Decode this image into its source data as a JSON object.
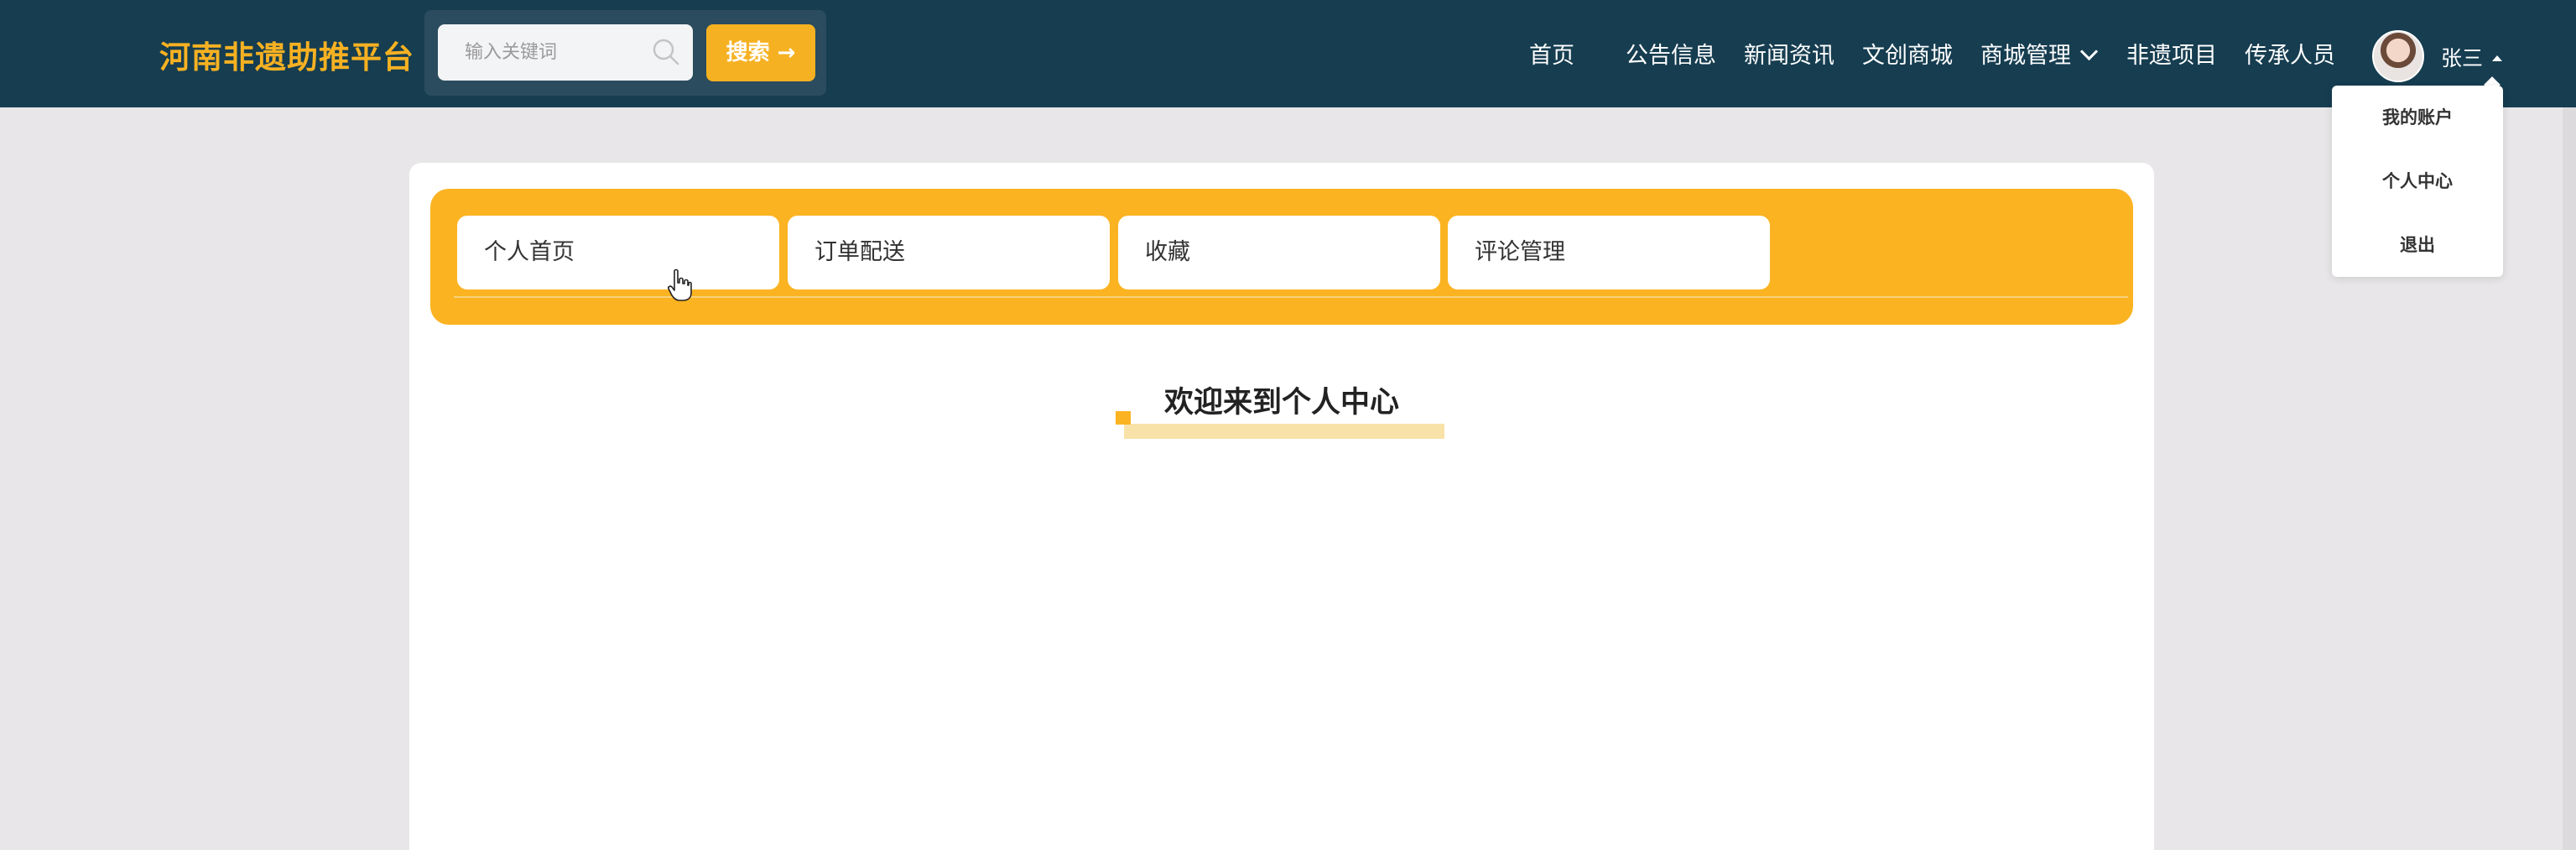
{
  "header": {
    "brand": "河南非遗助推平台",
    "search": {
      "placeholder": "输入关键词",
      "button_label": "搜索 →"
    },
    "nav": [
      {
        "label": "首页"
      },
      {
        "label": "公告信息"
      },
      {
        "label": "新闻资讯"
      },
      {
        "label": "文创商城"
      },
      {
        "label": "商城管理"
      },
      {
        "label": "非遗项目"
      },
      {
        "label": "传承人员"
      }
    ],
    "user": {
      "name": "张三"
    }
  },
  "user_menu": {
    "items": [
      {
        "label": "我的账户"
      },
      {
        "label": "个人中心"
      },
      {
        "label": "退出"
      }
    ]
  },
  "main": {
    "tabs": [
      {
        "label": "个人首页"
      },
      {
        "label": "订单配送"
      },
      {
        "label": "收藏"
      },
      {
        "label": "评论管理"
      }
    ],
    "welcome_title": "欢迎来到个人中心"
  },
  "colors": {
    "header_bg": "#163d50",
    "accent": "#fbb322",
    "page_bg": "#e8e6e8"
  }
}
